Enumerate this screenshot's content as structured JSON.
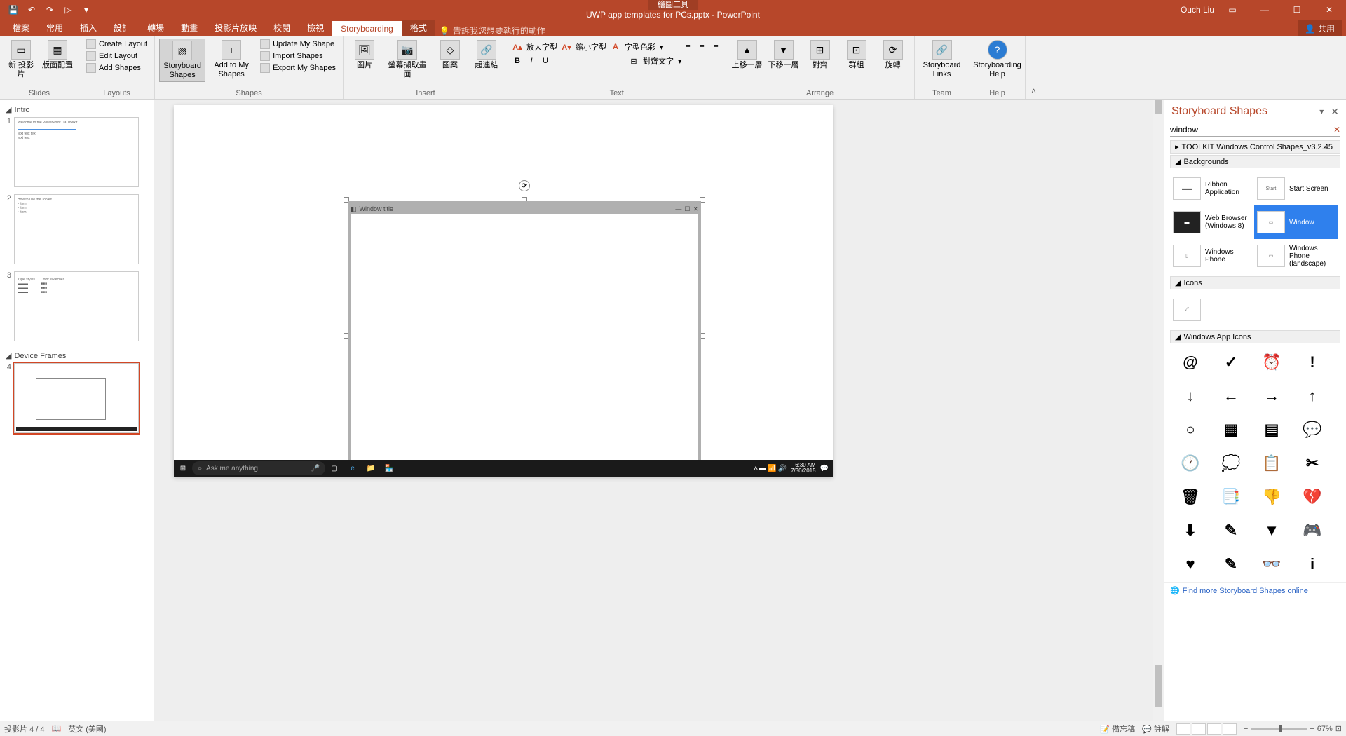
{
  "titlebar": {
    "drawing_tools": "繪圖工具",
    "title": "UWP app templates for PCs.pptx - PowerPoint",
    "user": "Ouch Liu"
  },
  "tabs": {
    "file": "檔案",
    "home": "常用",
    "insert": "插入",
    "design": "設計",
    "transitions": "轉場",
    "animations": "動畫",
    "slideshow": "投影片放映",
    "review": "校閱",
    "view": "檢視",
    "storyboarding": "Storyboarding",
    "format": "格式",
    "tell_me": "告訴我您想要執行的動作",
    "share": "共用"
  },
  "ribbon": {
    "slides": {
      "new_slide": "新\n投影片",
      "layout": "版面配置",
      "label": "Slides"
    },
    "layouts": {
      "create": "Create Layout",
      "edit": "Edit Layout",
      "add": "Add Shapes",
      "label": "Layouts"
    },
    "shapes": {
      "storyboard": "Storyboard\nShapes",
      "add_to_my": "Add to My\nShapes",
      "update": "Update My Shape",
      "import": "Import Shapes",
      "export": "Export My Shapes",
      "label": "Shapes"
    },
    "insert": {
      "pic": "圖片",
      "screenshot": "螢幕擷取畫面",
      "album": "圖案",
      "link": "超連結",
      "label": "Insert"
    },
    "text": {
      "grow": "放大字型",
      "shrink": "縮小字型",
      "color": "字型色彩",
      "bold": "B",
      "italic": "I",
      "underline": "U",
      "align": "對齊文字",
      "label": "Text"
    },
    "arrange": {
      "forward": "上移一層",
      "backward": "下移一層",
      "align": "對齊",
      "group": "群組",
      "rotate": "旋轉",
      "label": "Arrange"
    },
    "team": {
      "links": "Storyboard\nLinks",
      "label": "Team"
    },
    "help": {
      "help": "Storyboarding\nHelp",
      "label": "Help"
    }
  },
  "sections": {
    "intro": "Intro",
    "device": "Device Frames"
  },
  "window_shape": {
    "title": "Window title"
  },
  "taskbar": {
    "search": "Ask me anything",
    "time": "6:30 AM",
    "date": "7/30/2015"
  },
  "pane": {
    "title": "Storyboard Shapes",
    "search": "window",
    "toolkit": "TOOLKIT Windows Control Shapes_v3.2.45",
    "cat_backgrounds": "Backgrounds",
    "cat_icons": "Icons",
    "cat_appicons": "Windows App Icons",
    "shapes": {
      "ribbon_app": "Ribbon Application",
      "start": "Start Screen",
      "browser": "Web Browser (Windows 8)",
      "window": "Window",
      "phone": "Windows Phone",
      "phone_l": "Windows Phone (landscape)"
    },
    "footer": "Find more Storyboard Shapes online"
  },
  "status": {
    "slide": "投影片 4 / 4",
    "lang": "英文 (美國)",
    "notes": "備忘稿",
    "comments": "註解",
    "zoom": "67%"
  },
  "icons_list": [
    "@",
    "✓",
    "⏰",
    "!",
    "↓",
    "←",
    "→",
    "↑",
    "○",
    "▦",
    "▤",
    "💬",
    "🕐",
    "💭",
    "📋",
    "✂",
    "🗑",
    "📑",
    "👎",
    "💔",
    "⬇",
    "✎",
    "▼",
    "🎮",
    "♥",
    "/",
    "👓",
    "i"
  ]
}
